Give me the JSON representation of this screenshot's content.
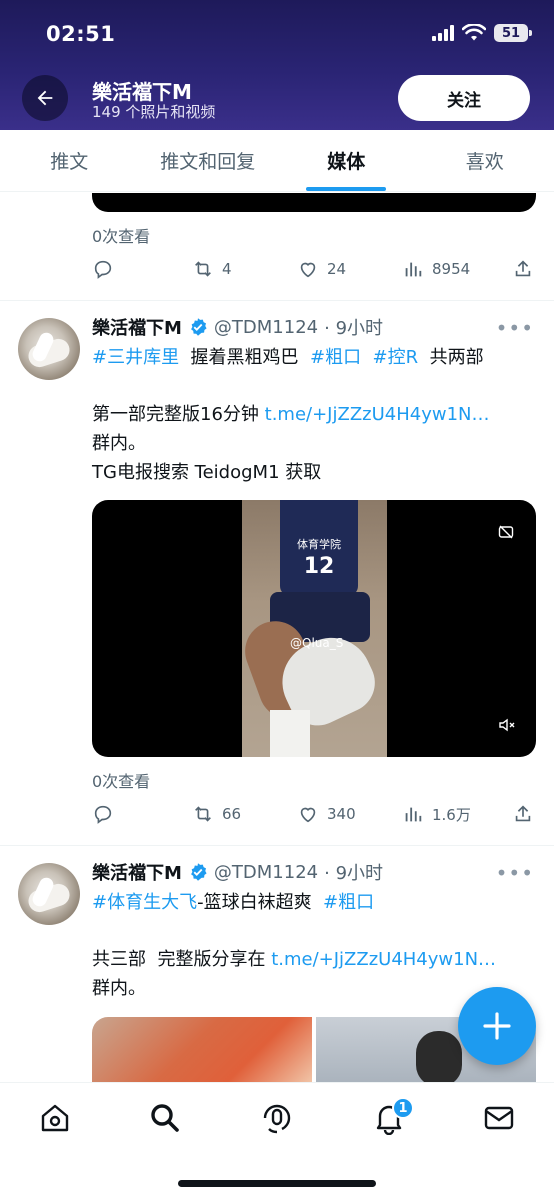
{
  "status_bar": {
    "time": "02:51",
    "battery": "51"
  },
  "header": {
    "title": "樂活襠下M",
    "subtitle": "149 个照片和视频",
    "follow_label": "关注"
  },
  "tabs": [
    {
      "label": "推文"
    },
    {
      "label": "推文和回复"
    },
    {
      "label": "媒体"
    },
    {
      "label": "喜欢"
    }
  ],
  "active_tab": "媒体",
  "tweets": [
    {
      "views": "0次查看",
      "replies": "",
      "retweets": "4",
      "likes": "24",
      "analytics": "8954"
    },
    {
      "name": "樂活襠下M",
      "handle": "@TDM1124",
      "time": "· 9小时",
      "more": "•••",
      "tag1": "#三井库里",
      "text1": "握着黑粗鸡巴",
      "tag2": "#粗口",
      "tag3": "#控R",
      "text2": "共两部",
      "line2_text": "第一部完整版16分钟",
      "link": "t.me/+JjZZzU4H4yw1N…",
      "line3": "群内。",
      "line4": "TG电报搜索 TeidogM1 获取",
      "video_watermark": "@Qlua_S",
      "jersey_text": "体育学院",
      "jersey_number": "12",
      "views": "0次查看",
      "retweets": "66",
      "likes": "340",
      "analytics": "1.6万"
    },
    {
      "name": "樂活襠下M",
      "handle": "@TDM1124",
      "time": "· 9小时",
      "more": "•••",
      "tag1": "#体育生大飞",
      "text1": "-篮球白袜超爽",
      "tag2": "#粗口",
      "line2_text": "共三部  完整版分享在",
      "link": "t.me/+JjZZzU4H4yw1N…",
      "line3": "群内。"
    }
  ],
  "bottom_nav": {
    "items": [
      "home-icon",
      "search-icon",
      "spaces-icon",
      "notifications-icon",
      "messages-icon"
    ],
    "notification_count": "1"
  },
  "colors": {
    "accent": "#1d9bf0",
    "header": "#2a2474",
    "text": "#0f1419",
    "muted": "#536471"
  }
}
